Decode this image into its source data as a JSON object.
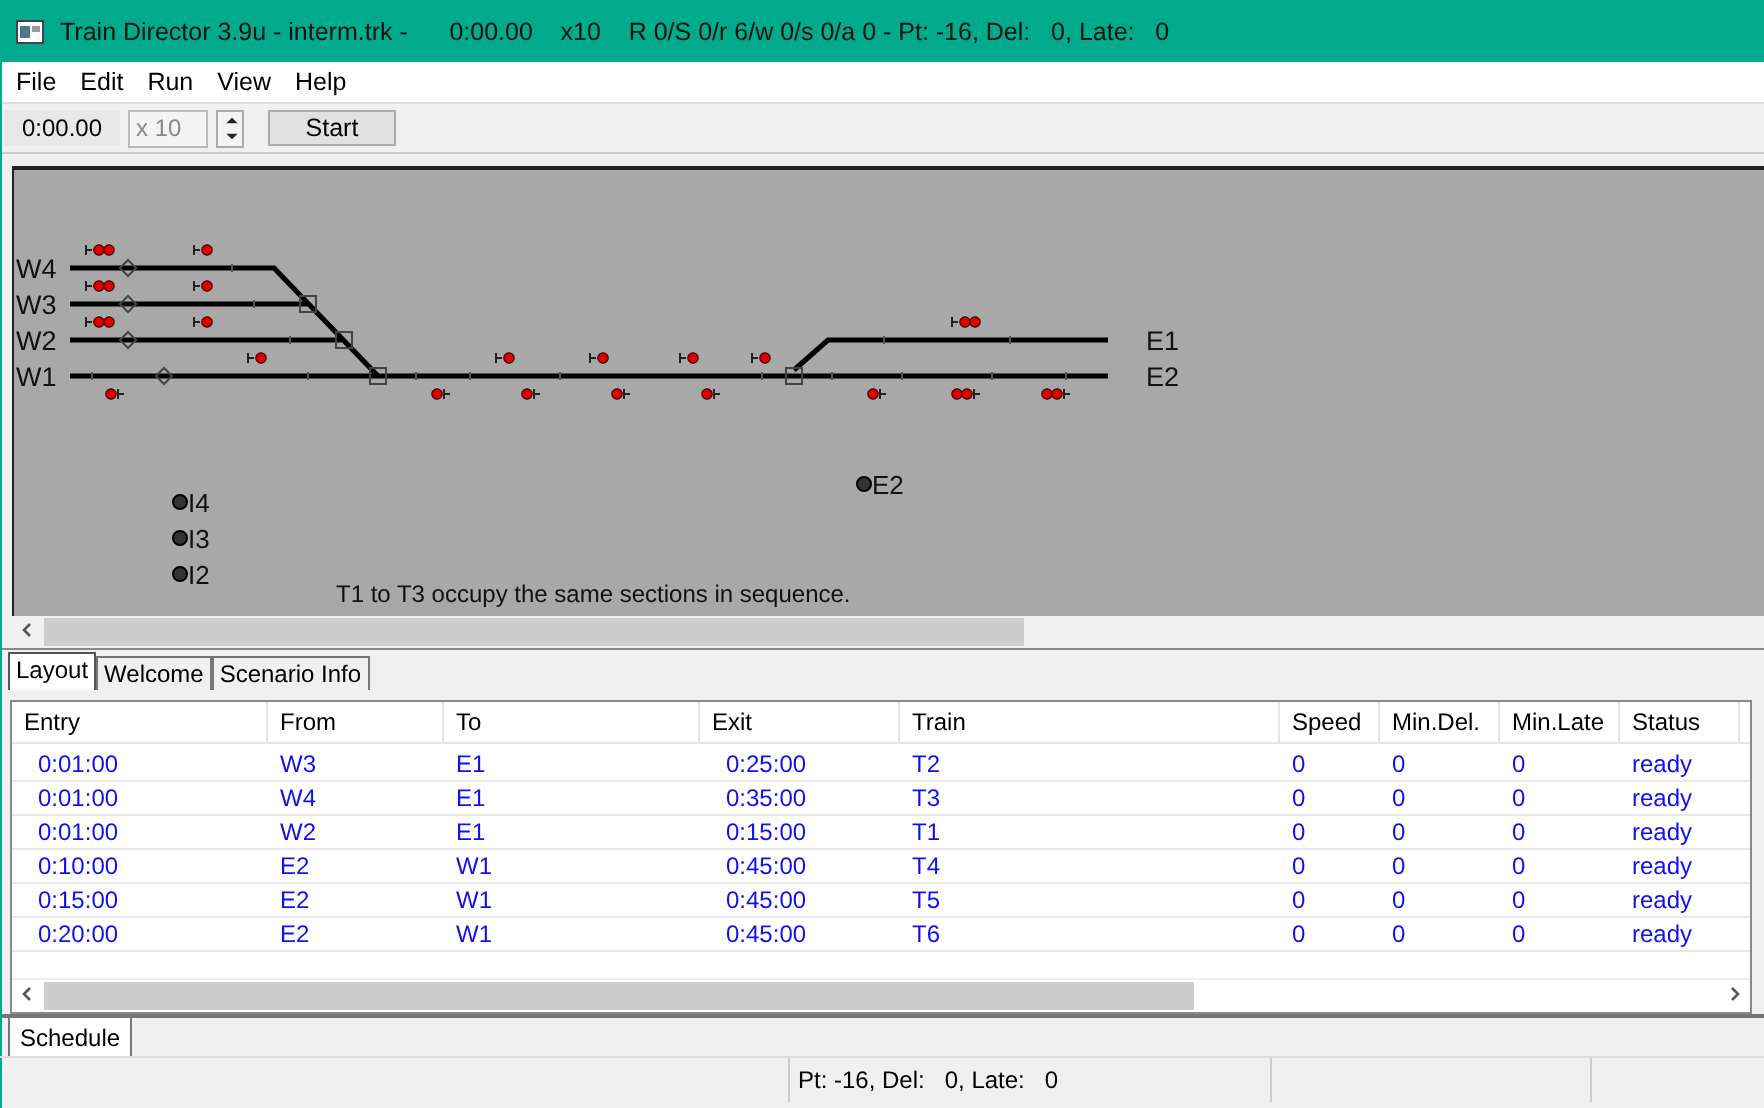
{
  "window": {
    "title": "Train Director 3.9u - interm.trk -      0:00.00    x10    R 0/S 0/r 6/w 0/s 0/a 0 - Pt: -16, Del:   0, Late:   0"
  },
  "menu": [
    "File",
    "Edit",
    "Run",
    "View",
    "Help"
  ],
  "toolbar": {
    "clock": "0:00.00",
    "speed": {
      "value": "x 10",
      "disabled": true
    },
    "start_button": "Start"
  },
  "layout": {
    "track_labels": [
      "W4",
      "W3",
      "W2",
      "W1",
      "E1",
      "E2"
    ],
    "places": [
      "E2",
      "I4",
      "I3",
      "I2"
    ],
    "message": "T1 to T3 occupy the same sections in sequence."
  },
  "tabs": [
    {
      "label": "Layout",
      "selected": true
    },
    {
      "label": "Welcome",
      "selected": false
    },
    {
      "label": "Scenario Info",
      "selected": false
    }
  ],
  "schedule": {
    "columns": [
      "Entry",
      "From",
      "To",
      "Exit",
      "Train",
      "Speed",
      "Min.Del.",
      "Min.Late",
      "Status"
    ],
    "rows": [
      [
        "0:01:00",
        "W3",
        "E1",
        "0:25:00",
        "T2",
        "0",
        "0",
        "0",
        "ready"
      ],
      [
        "0:01:00",
        "W4",
        "E1",
        "0:35:00",
        "T3",
        "0",
        "0",
        "0",
        "ready"
      ],
      [
        "0:01:00",
        "W2",
        "E1",
        "0:15:00",
        "T1",
        "0",
        "0",
        "0",
        "ready"
      ],
      [
        "0:10:00",
        "E2",
        "W1",
        "0:45:00",
        "T4",
        "0",
        "0",
        "0",
        "ready"
      ],
      [
        "0:15:00",
        "E2",
        "W1",
        "0:45:00",
        "T5",
        "0",
        "0",
        "0",
        "ready"
      ],
      [
        "0:20:00",
        "E2",
        "W1",
        "0:45:00",
        "T6",
        "0",
        "0",
        "0",
        "ready"
      ]
    ]
  },
  "bottom_tabs": [
    {
      "label": "Schedule",
      "selected": true
    }
  ],
  "status_bar": [
    "Pt: -16, Del:   0, Late:   0"
  ]
}
